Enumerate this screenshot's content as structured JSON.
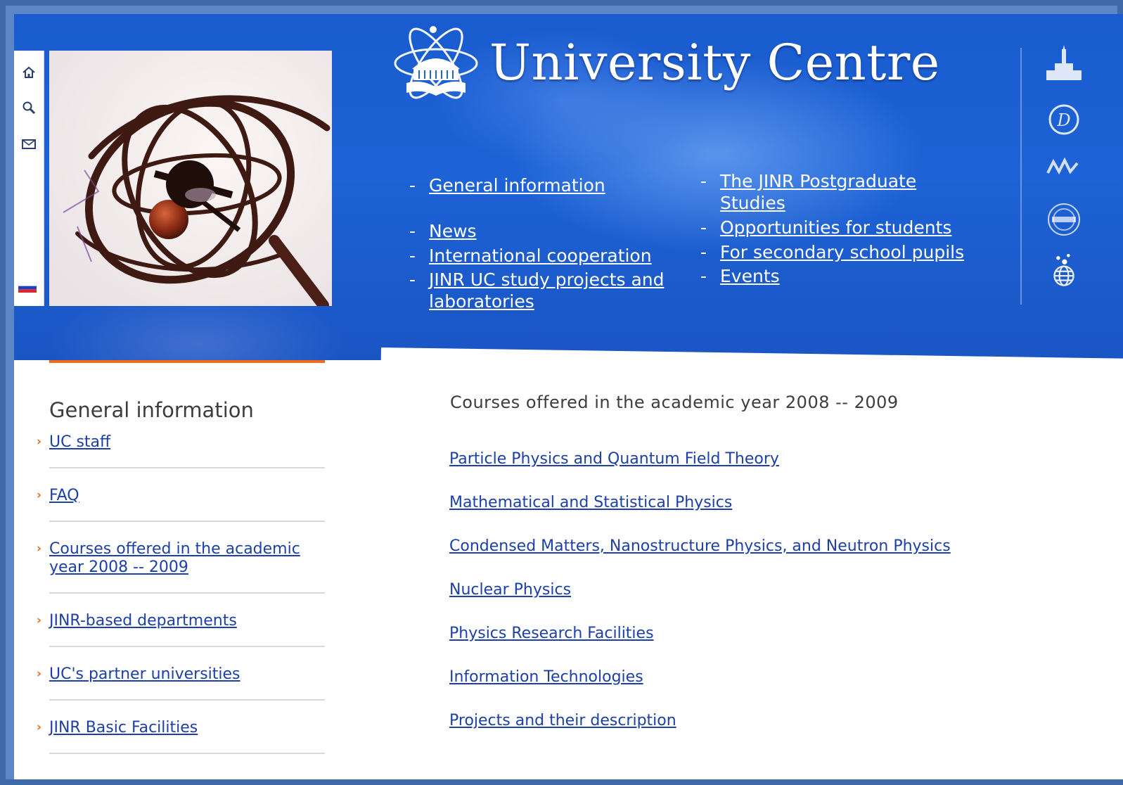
{
  "header": {
    "title": "University Centre"
  },
  "nav": {
    "left": [
      {
        "label": "General information"
      },
      {
        "label": "News"
      },
      {
        "label": "International cooperation"
      },
      {
        "label": "JINR UC study projects and laboratories"
      }
    ],
    "right": [
      {
        "label": "The JINR Postgraduate Studies"
      },
      {
        "label": "Opportunities for students"
      },
      {
        "label": "For secondary school pupils"
      },
      {
        "label": "Events"
      }
    ],
    "dash": "-"
  },
  "rail": {
    "icons": [
      "home-icon",
      "search-icon",
      "mail-icon",
      "russian-flag-icon"
    ]
  },
  "partners": [
    "msu-building-logo",
    "dubna-university-logo",
    "mephi-logo",
    "mirea-logo",
    "globe-logo"
  ],
  "sidebar": {
    "title": "General information",
    "arrow": "›",
    "items": [
      {
        "label": "UC staff"
      },
      {
        "label": "FAQ"
      },
      {
        "label": "Courses offered in the academic year 2008 -- 2009"
      },
      {
        "label": "JINR-based departments"
      },
      {
        "label": "UC's partner universities"
      },
      {
        "label": "JINR Basic Facilities"
      }
    ]
  },
  "content": {
    "title": "Courses offered in the academic year 2008 -- 2009",
    "courses": [
      {
        "label": "Particle Physics and Quantum Field Theory"
      },
      {
        "label": "Mathematical and Statistical Physics"
      },
      {
        "label": "Condensed Matters, Nanostructure Physics, and Neutron Physics"
      },
      {
        "label": "Nuclear Physics"
      },
      {
        "label": "Physics Research Facilities"
      },
      {
        "label": "Information Technologies"
      },
      {
        "label": "Projects and their description"
      }
    ]
  },
  "colors": {
    "header_blue": "#1d62d6",
    "link": "#1c3fa8",
    "accent": "#ef6b1e"
  }
}
